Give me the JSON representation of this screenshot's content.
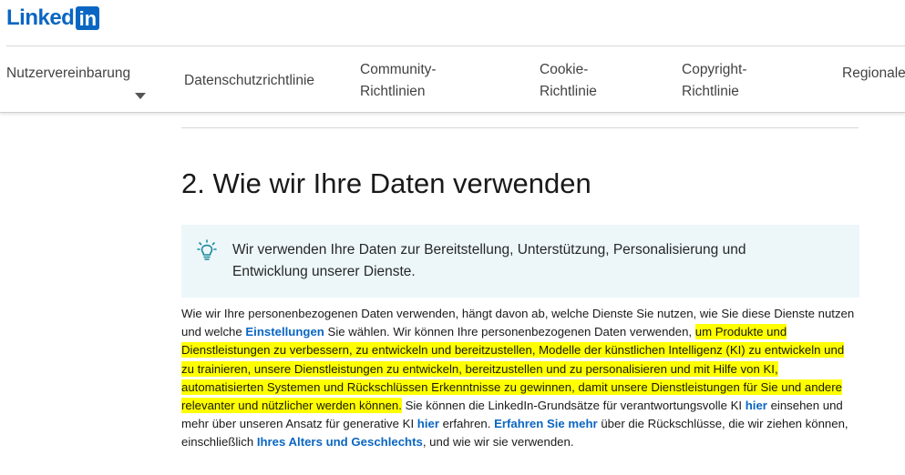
{
  "brand": {
    "logo_text": "Linked",
    "logo_in": "in",
    "color": "#0a66c2"
  },
  "nav": {
    "items": [
      {
        "label": "Nutzervereinbarung",
        "has_caret": true
      },
      {
        "label": "Datenschutzrichtlinie"
      },
      {
        "label_line1": "Community-",
        "label_line2": "Richtlinien"
      },
      {
        "label_line1": "Cookie-",
        "label_line2": "Richtlinie"
      },
      {
        "label_line1": "Copyright-",
        "label_line2": "Richtlinie"
      },
      {
        "label": "Regionale"
      }
    ]
  },
  "section": {
    "title": "2. Wie wir Ihre Daten verwenden",
    "callout": {
      "icon": "lightbulb-icon",
      "text": "Wir verwenden Ihre Daten zur Bereitstellung, Unterstützung, Personalisierung und Entwicklung unserer Dienste."
    },
    "paragraph": {
      "t1": "Wie wir Ihre personenbezogenen Daten verwenden, hängt davon ab, welche Dienste Sie nutzen, wie Sie diese Dienste nutzen und welche ",
      "link_settings": "Einstellungen",
      "t2": " Sie wählen. Wir können Ihre personenbezogenen Daten verwenden, ",
      "highlighted": "um Produkte und Dienstleistungen zu verbessern, zu entwickeln und bereitzustellen, Modelle der künstlichen Intelligenz (KI) zu entwickeln und zu trainieren, unsere Dienstleistungen zu entwickeln, bereitzustellen und zu personalisieren und mit Hilfe von KI, automatisierten Systemen und Rückschlüssen Erkenntnisse zu gewinnen, damit unsere Dienstleistungen für Sie und andere relevanter und nützlicher werden können.",
      "t3": " Sie können die LinkedIn-Grundsätze für verantwortungsvolle KI ",
      "link_hier1": "hier",
      "t4": " einsehen und mehr über unseren Ansatz für generative KI ",
      "link_hier2": "hier",
      "t5": " erfahren. ",
      "link_more": "Erfahren Sie mehr",
      "t6": " über die Rückschlüsse, die wir ziehen können, einschließlich ",
      "link_age": "Ihres Alters und Geschlechts",
      "t7": ", und wie wir sie verwenden."
    },
    "highlight_color": "#ffff00",
    "link_color": "#0a66c2",
    "callout_bg": "#edf7fa"
  }
}
